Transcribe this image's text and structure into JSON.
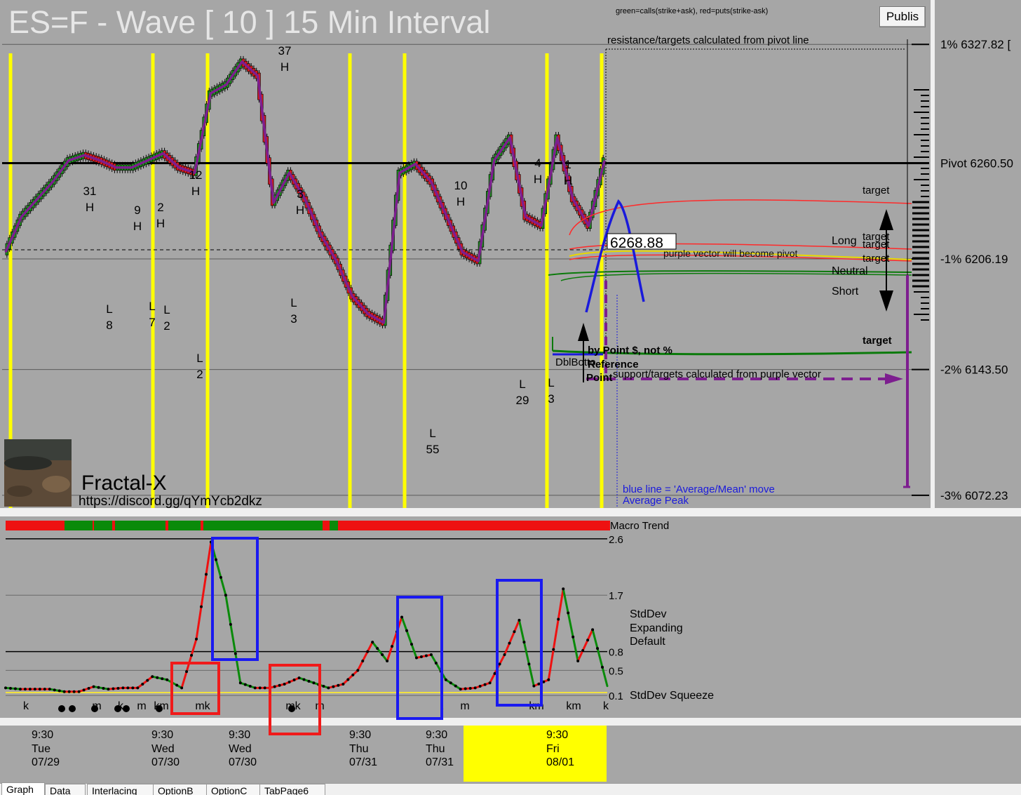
{
  "header": {
    "title": "ES=F - Wave [ 10 ] 15 Min Interval",
    "legend": "green=calls(strike+ask), red=puts(strike-ask)",
    "publish_button": "Publis"
  },
  "price_axis": {
    "labels": [
      "1% 6327.82 [",
      "Pivot 6260.50",
      "-1% 6206.19",
      "-2% 6143.50",
      "-3% 6072.23"
    ]
  },
  "annotations": {
    "resistance_note": "resistance/targets calculated from pivot line",
    "support_note": "support/targets calculated from purple vector",
    "price_box": "6268.88",
    "purple_vector_note": "purple vector will become pivot",
    "by_points": "by Point $, not %",
    "dbl_bottom": "DblBotto",
    "reference": "Reference",
    "point": "Point",
    "blue_line_note": "blue line = 'Average/Mean' move",
    "average_peak": "Average Peak",
    "long": "Long",
    "neutral": "Neutral",
    "short": "Short",
    "target": "target"
  },
  "branding": {
    "name": "Fractal-X",
    "url": "https://discord.gg/qYmYcb2dkz"
  },
  "wave_labels": {
    "highs": [
      {
        "count": "31",
        "tag": "H"
      },
      {
        "count": "9",
        "tag": "H"
      },
      {
        "count": "2",
        "tag": "H"
      },
      {
        "count": "12",
        "tag": "H"
      },
      {
        "count": "37",
        "tag": "H"
      },
      {
        "count": "3",
        "tag": "H"
      },
      {
        "count": "10",
        "tag": "H"
      },
      {
        "count": "4",
        "tag": "H"
      },
      {
        "count": "1",
        "tag": "H"
      }
    ],
    "lows": [
      {
        "tag": "L",
        "count": "8"
      },
      {
        "tag": "L",
        "count": "7"
      },
      {
        "tag": "L",
        "count": "2"
      },
      {
        "tag": "L",
        "count": "2"
      },
      {
        "tag": "L",
        "count": "3"
      },
      {
        "tag": "L",
        "count": "55"
      },
      {
        "tag": "L",
        "count": "29"
      },
      {
        "tag": "L",
        "count": "3"
      }
    ]
  },
  "indicator": {
    "macro_trend_label": "Macro Trend",
    "stddev_expanding": [
      "StdDev",
      "Expanding",
      "Default"
    ],
    "stddev_squeeze": "StdDev Squeeze",
    "markers": [
      "k",
      "m",
      "k",
      "m",
      "km",
      "mk",
      "mk",
      "m",
      "t",
      "m",
      "km",
      "km",
      "k"
    ]
  },
  "time_axis": {
    "sessions": [
      {
        "time": "9:30",
        "day": "Tue",
        "date": "07/29"
      },
      {
        "time": "9:30",
        "day": "Wed",
        "date": "07/30"
      },
      {
        "time": "9:30",
        "day": "Wed",
        "date": "07/30"
      },
      {
        "time": "9:30",
        "day": "Thu",
        "date": "07/31"
      },
      {
        "time": "9:30",
        "day": "Thu",
        "date": "07/31"
      },
      {
        "time": "9:30",
        "day": "Fri",
        "date": "08/01",
        "highlight": true
      }
    ]
  },
  "tabs": [
    "Graph",
    "Data",
    "Interlacing",
    "OptionB",
    "OptionC",
    "TabPage6"
  ],
  "colors": {
    "chart_bg": "#a6a6a6",
    "price_line": "#7d1e8f",
    "session_line": "#ffff00",
    "up_candle": "#1a8a1a",
    "down_candle": "#d41a1a",
    "avg_move": "#1a1adc"
  },
  "chart_data": [
    {
      "type": "line",
      "title": "ES=F - Wave [ 10 ] 15 Min Interval",
      "series": [],
      "y": [
        6210,
        6230,
        6240,
        6250,
        6262,
        6265,
        6262,
        6258,
        6258,
        6262,
        6266,
        6258,
        6255,
        6300,
        6305,
        6318,
        6310,
        6238,
        6255,
        6240,
        6220,
        6205,
        6185,
        6175,
        6170,
        6255,
        6260,
        6250,
        6230,
        6210,
        6205,
        6262,
        6275,
        6230,
        6225,
        6275,
        6240,
        6225,
        6262
      ],
      "pivot": 6260.5,
      "ylim": [
        6065,
        6345
      ],
      "yticks": [
        6327.82,
        6260.5,
        6206.19,
        6143.5,
        6072.23
      ],
      "grid": true
    },
    {
      "type": "line",
      "title": "",
      "series": [],
      "y": [
        0.22,
        0.2,
        0.2,
        0.2,
        0.16,
        0.16,
        0.24,
        0.2,
        0.22,
        0.22,
        0.4,
        0.35,
        0.22,
        1.0,
        2.55,
        1.7,
        0.3,
        0.22,
        0.22,
        0.28,
        0.38,
        0.3,
        0.22,
        0.28,
        0.5,
        0.95,
        0.65,
        1.35,
        0.7,
        0.75,
        0.35,
        0.2,
        0.22,
        0.3,
        0.75,
        1.3,
        0.25,
        0.35,
        1.8,
        0.65,
        1.15,
        0.25
      ],
      "ylim": [
        0,
        2.8
      ],
      "yticks": [
        0.1,
        0.5,
        0.8,
        1.7,
        2.6
      ],
      "grid": true
    }
  ]
}
